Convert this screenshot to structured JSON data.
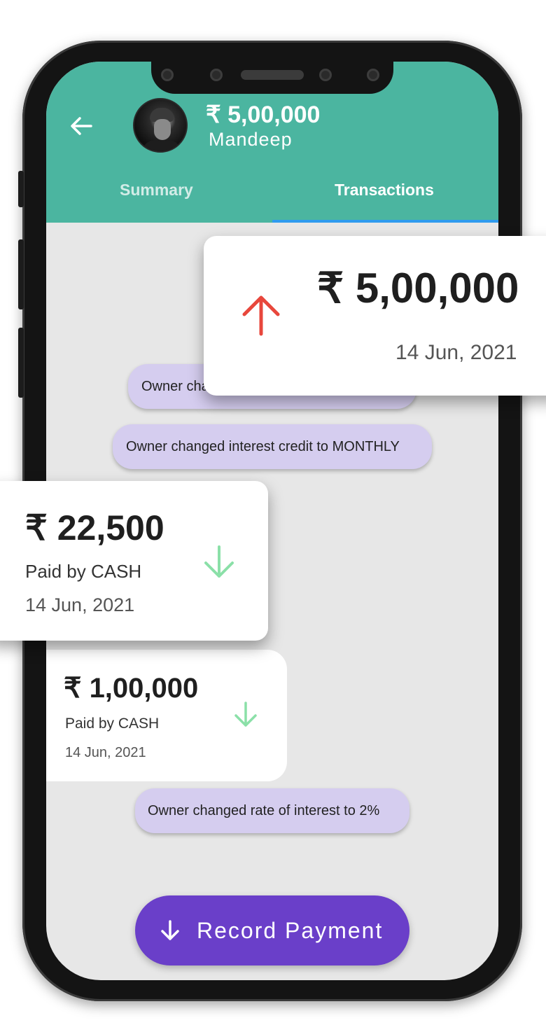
{
  "header": {
    "amount": "₹ 5,00,000",
    "name": "Mandeep"
  },
  "tabs": [
    {
      "label": "Summary",
      "active": false
    },
    {
      "label": "Transactions",
      "active": true
    }
  ],
  "messages": [
    {
      "text": "Owner cha"
    },
    {
      "text": "Owner changed interest credit to MONTHLY"
    },
    {
      "text": "Owner changed rate of interest to 2%"
    }
  ],
  "transactions": [
    {
      "amount": "₹ 5,00,000",
      "date": "14 Jun, 2021",
      "direction": "up",
      "color": "#e8473c"
    },
    {
      "amount": "₹ 22,500",
      "method": "Paid by CASH",
      "date": "14 Jun, 2021",
      "direction": "down",
      "color": "#8be0a8"
    },
    {
      "amount": "₹ 1,00,000",
      "method": "Paid by CASH",
      "date": "14 Jun, 2021",
      "direction": "down",
      "color": "#8be0a8"
    }
  ],
  "record_button": {
    "label": "Record Payment"
  },
  "colors": {
    "header": "#4bb5a0",
    "accent": "#6a3fc9",
    "pill": "#d5cdef",
    "tab_indicator": "#2f9bef"
  }
}
